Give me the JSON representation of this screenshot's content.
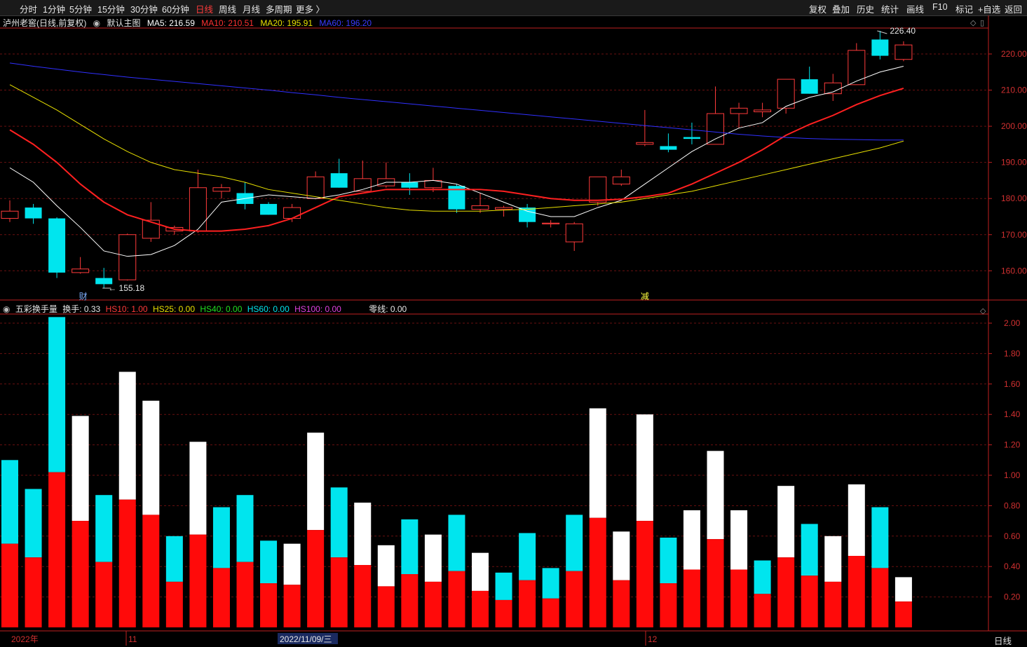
{
  "toolbar": {
    "left": [
      "分时",
      "1分钟",
      "5分钟",
      "15分钟",
      "30分钟",
      "60分钟",
      "日线",
      "周线",
      "月线",
      "多周期",
      "更多 〉"
    ],
    "active": "日线",
    "right": [
      "复权",
      "叠加",
      "历史",
      "统计",
      "画线",
      "F10",
      "标记",
      "+自选",
      "返回"
    ]
  },
  "main_info": {
    "stock": "泸州老窖(日线,前复权)",
    "template": "默认主图",
    "ma5": "MA5: 216.59",
    "ma10": "MA10: 210.51",
    "ma20": "MA20: 195.91",
    "ma60": "MA60: 196.20"
  },
  "vol_info": {
    "name": "五彩换手量",
    "turnover": "换手: 0.33",
    "hs10": "HS10: 1.00",
    "hs25": "HS25: 0.00",
    "hs40": "HS40: 0.00",
    "hs60": "HS60: 0.00",
    "hs100": "HS100: 0.00",
    "zero": "零线: 0.00"
  },
  "colors": {
    "up": "#ff3b3b",
    "down": "#00e5ee",
    "ma5": "#ffffff",
    "ma10": "#ff2020",
    "ma20": "#e8e000",
    "ma60": "#3030ff",
    "grid": "#6a1010",
    "axis": "#c02020"
  },
  "annotations": {
    "high": "226.40",
    "low": "155.18",
    "mark_cai": "财",
    "mark_jian": "减",
    "date_1": "2022年",
    "date_2": "11",
    "date_3": "2022/11/09/三",
    "date_4": "12",
    "period": "日线"
  },
  "chart_data": [
    {
      "type": "candlestick",
      "title": "泸州老窖(日线,前复权)",
      "ylim": [
        155,
        230
      ],
      "y_ticks": [
        160,
        170,
        180,
        190,
        200,
        210,
        220
      ],
      "candles": [
        {
          "o": 174.5,
          "h": 179.5,
          "l": 173.5,
          "c": 176.5
        },
        {
          "o": 177.5,
          "h": 178.5,
          "l": 173.0,
          "c": 174.5
        },
        {
          "o": 174.5,
          "h": 174.8,
          "l": 158.0,
          "c": 159.5
        },
        {
          "o": 159.5,
          "h": 163.8,
          "l": 159.2,
          "c": 160.5
        },
        {
          "o": 158.0,
          "h": 160.8,
          "l": 155.2,
          "c": 156.3
        },
        {
          "o": 157.5,
          "h": 170.3,
          "l": 157.3,
          "c": 170.0
        },
        {
          "o": 169.0,
          "h": 179.0,
          "l": 168.0,
          "c": 174.0
        },
        {
          "o": 171.0,
          "h": 172.5,
          "l": 170.0,
          "c": 172.0
        },
        {
          "o": 171.0,
          "h": 188.0,
          "l": 170.5,
          "c": 183.0
        },
        {
          "o": 182.0,
          "h": 184.0,
          "l": 180.0,
          "c": 183.0
        },
        {
          "o": 181.5,
          "h": 184.5,
          "l": 177.0,
          "c": 178.5
        },
        {
          "o": 178.5,
          "h": 179.0,
          "l": 175.5,
          "c": 175.5
        },
        {
          "o": 174.5,
          "h": 178.5,
          "l": 173.5,
          "c": 177.5
        },
        {
          "o": 180.0,
          "h": 187.5,
          "l": 179.8,
          "c": 186.0
        },
        {
          "o": 187.0,
          "h": 191.0,
          "l": 183.0,
          "c": 183.0
        },
        {
          "o": 182.0,
          "h": 190.5,
          "l": 182.0,
          "c": 185.5
        },
        {
          "o": 183.5,
          "h": 190.0,
          "l": 183.0,
          "c": 185.5
        },
        {
          "o": 184.5,
          "h": 187.0,
          "l": 181.0,
          "c": 183.0
        },
        {
          "o": 183.0,
          "h": 188.5,
          "l": 181.8,
          "c": 185.0
        },
        {
          "o": 183.5,
          "h": 184.0,
          "l": 176.0,
          "c": 177.0
        },
        {
          "o": 177.0,
          "h": 181.5,
          "l": 176.0,
          "c": 178.0
        },
        {
          "o": 177.0,
          "h": 178.0,
          "l": 175.0,
          "c": 177.5
        },
        {
          "o": 177.5,
          "h": 178.5,
          "l": 172.0,
          "c": 173.5
        },
        {
          "o": 173.0,
          "h": 174.0,
          "l": 172.0,
          "c": 173.2
        },
        {
          "o": 168.0,
          "h": 173.5,
          "l": 165.5,
          "c": 173.0
        },
        {
          "o": 179.0,
          "h": 186.0,
          "l": 178.0,
          "c": 186.0
        },
        {
          "o": 184.0,
          "h": 188.0,
          "l": 183.5,
          "c": 186.0
        },
        {
          "o": 195.0,
          "h": 204.5,
          "l": 194.5,
          "c": 195.5
        },
        {
          "o": 194.5,
          "h": 198.0,
          "l": 192.8,
          "c": 193.5
        },
        {
          "o": 197.0,
          "h": 201.0,
          "l": 195.0,
          "c": 196.5
        },
        {
          "o": 195.0,
          "h": 211.0,
          "l": 195.0,
          "c": 203.5
        },
        {
          "o": 203.5,
          "h": 206.5,
          "l": 199.5,
          "c": 205.0
        },
        {
          "o": 204.0,
          "h": 206.5,
          "l": 202.5,
          "c": 204.5
        },
        {
          "o": 205.0,
          "h": 213.0,
          "l": 203.5,
          "c": 213.0
        },
        {
          "o": 213.0,
          "h": 216.5,
          "l": 209.0,
          "c": 209.0
        },
        {
          "o": 209.0,
          "h": 214.5,
          "l": 207.0,
          "c": 212.0
        },
        {
          "o": 211.5,
          "h": 223.0,
          "l": 211.5,
          "c": 221.0
        },
        {
          "o": 224.0,
          "h": 226.4,
          "l": 218.5,
          "c": 219.5
        },
        {
          "o": 218.5,
          "h": 223.5,
          "l": 218.0,
          "c": 222.5
        }
      ],
      "series": [
        {
          "name": "MA5",
          "color": "#ffffff",
          "values": [
            188.5,
            184.5,
            178.0,
            172.0,
            165.5,
            164.0,
            164.5,
            167.0,
            171.5,
            179.0,
            180.0,
            181.0,
            180.5,
            180.0,
            181.0,
            182.5,
            184.5,
            184.5,
            185.0,
            184.0,
            181.5,
            179.0,
            176.5,
            175.0,
            175.0,
            177.5,
            179.5,
            184.0,
            188.5,
            193.0,
            196.5,
            199.5,
            201.0,
            205.5,
            208.0,
            209.5,
            212.5,
            215.0,
            216.6
          ]
        },
        {
          "name": "MA10",
          "color": "#ff2020",
          "values": [
            199.0,
            195.0,
            190.0,
            184.0,
            179.0,
            175.5,
            173.5,
            171.5,
            171.0,
            171.0,
            171.5,
            172.5,
            174.5,
            177.5,
            180.5,
            181.5,
            182.5,
            182.5,
            182.5,
            182.5,
            182.5,
            182.0,
            181.0,
            180.0,
            179.5,
            179.5,
            179.8,
            180.5,
            181.5,
            184.0,
            187.0,
            190.0,
            193.5,
            197.5,
            200.5,
            203.0,
            206.0,
            208.5,
            210.5
          ]
        },
        {
          "name": "MA20",
          "color": "#e8e000",
          "values": [
            211.5,
            208.0,
            204.5,
            200.5,
            196.5,
            193.0,
            190.0,
            188.0,
            187.0,
            186.0,
            184.5,
            182.5,
            181.5,
            180.5,
            179.5,
            178.5,
            177.5,
            176.8,
            176.5,
            176.5,
            176.5,
            176.8,
            177.0,
            177.5,
            178.0,
            178.5,
            179.0,
            180.0,
            181.0,
            182.0,
            183.5,
            185.0,
            186.5,
            188.0,
            189.5,
            191.0,
            192.5,
            194.0,
            195.9
          ]
        },
        {
          "name": "MA60",
          "color": "#3030ff",
          "values": [
            217.5,
            216.6,
            215.8,
            215.0,
            214.3,
            213.6,
            213.0,
            212.4,
            211.8,
            211.2,
            210.6,
            210.0,
            209.3,
            208.7,
            208.0,
            207.4,
            206.8,
            206.2,
            205.6,
            205.0,
            204.4,
            203.8,
            203.2,
            202.6,
            202.0,
            201.4,
            200.8,
            200.2,
            199.6,
            199.0,
            198.4,
            197.8,
            197.3,
            196.9,
            196.6,
            196.4,
            196.3,
            196.2,
            196.2
          ]
        }
      ]
    },
    {
      "type": "bar",
      "title": "五彩换手量",
      "ylim": [
        0,
        2.2
      ],
      "y_ticks": [
        0.2,
        0.4,
        0.6,
        0.8,
        1.0,
        1.2,
        1.4,
        1.6,
        1.8,
        2.0
      ],
      "totals": [
        1.1,
        0.91,
        2.04,
        1.39,
        0.87,
        1.68,
        1.49,
        0.6,
        1.22,
        0.79,
        0.87,
        0.57,
        0.55,
        1.28,
        0.92,
        0.82,
        0.54,
        0.71,
        0.61,
        0.74,
        0.49,
        0.36,
        0.62,
        0.39,
        0.74,
        1.44,
        0.63,
        1.4,
        0.59,
        0.77,
        1.16,
        0.77,
        0.44,
        0.93,
        0.68,
        0.6,
        0.94,
        0.79,
        0.33
      ],
      "base": [
        0.55,
        0.46,
        1.02,
        0.7,
        0.43,
        0.84,
        0.74,
        0.3,
        0.61,
        0.39,
        0.43,
        0.29,
        0.28,
        0.64,
        0.46,
        0.41,
        0.27,
        0.35,
        0.3,
        0.37,
        0.24,
        0.18,
        0.31,
        0.19,
        0.37,
        0.72,
        0.31,
        0.7,
        0.29,
        0.38,
        0.58,
        0.38,
        0.22,
        0.46,
        0.34,
        0.3,
        0.47,
        0.39,
        0.17
      ],
      "top_color": [
        "down",
        "down",
        "down",
        "up",
        "down",
        "up",
        "up",
        "down",
        "up",
        "down",
        "down",
        "down",
        "up",
        "up",
        "down",
        "up",
        "up",
        "down",
        "up",
        "down",
        "up",
        "down",
        "down",
        "down",
        "down",
        "up",
        "up",
        "up",
        "down",
        "up",
        "up",
        "up",
        "down",
        "up",
        "down",
        "up",
        "up",
        "down",
        "up"
      ]
    }
  ]
}
